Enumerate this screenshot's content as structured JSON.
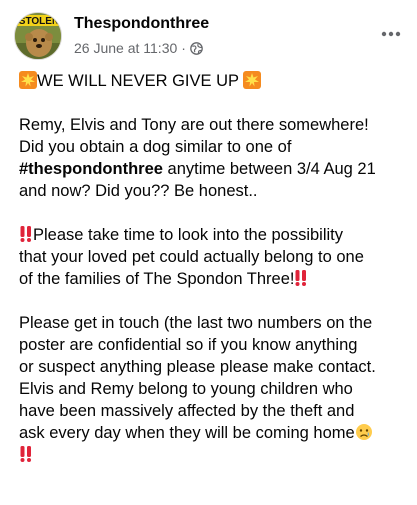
{
  "post": {
    "author": "Thespondonthree",
    "date": "26 June at 11:30",
    "separator": "·",
    "avatar_badge": "STOLEN",
    "privacy_icon": "globe-icon",
    "more_icon": "more-horizontal-icon"
  },
  "body": {
    "heading": "WE WILL NEVER GIVE UP",
    "p1_l1": "Remy, Elvis and Tony are out there somewhere!",
    "p1_l2": "Did you obtain a dog similar to one of",
    "p1_l3_tag": "#thespondonthree",
    "p1_l3_rest": " anytime between 3/4 Aug 21",
    "p1_l4": "and now? Did you?? Be honest..",
    "p2_l1": "Please take time to look into the possibility",
    "p2_l2": "that your loved pet could actually belong to one",
    "p2_l3": "of the families of The Spondon Three!",
    "p3_l1": "Please get in touch (the last two numbers on the",
    "p3_l2": "poster are confidential so if you know anything",
    "p3_l3": "or suspect anything please please make contact.",
    "p3_l4": "Elvis and Remy belong to young children who",
    "p3_l5": "have been massively affected by the theft and",
    "p3_l6": "ask every day when they will be coming home"
  },
  "colors": {
    "text": "#050505",
    "meta": "#65676b",
    "emoji_burst": "#f5a623",
    "emoji_bang": "#e0243a"
  }
}
